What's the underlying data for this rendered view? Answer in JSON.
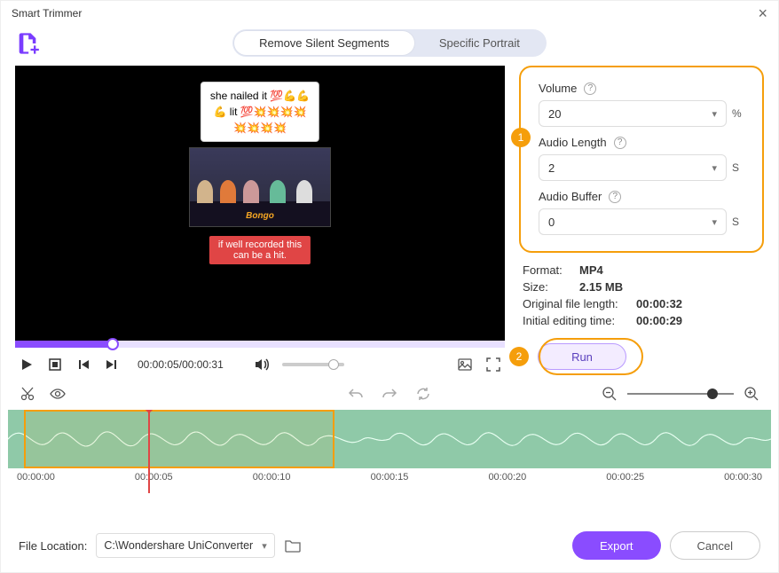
{
  "window": {
    "title": "Smart Trimmer"
  },
  "tabs": {
    "remove": "Remove Silent Segments",
    "portrait": "Specific Portrait"
  },
  "sticker": {
    "line1": "she nailed it 💯💪💪",
    "line2": "💪 lit 💯💥💥💥💥",
    "line3": "💥💥💥💥"
  },
  "caption": {
    "line1": "if well recorded this",
    "line2": "can be a hit."
  },
  "brand": "Bongo",
  "playback": {
    "current": "00:00:05",
    "total": "00:00:31"
  },
  "params": {
    "volume_label": "Volume",
    "volume_value": "20",
    "volume_unit": "%",
    "length_label": "Audio Length",
    "length_value": "2",
    "length_unit": "S",
    "buffer_label": "Audio Buffer",
    "buffer_value": "0",
    "buffer_unit": "S"
  },
  "meta": {
    "format_label": "Format:",
    "format_value": "MP4",
    "size_label": "Size:",
    "size_value": "2.15 MB",
    "orig_label": "Original file length:",
    "orig_value": "00:00:32",
    "init_label": "Initial editing time:",
    "init_value": "00:00:29"
  },
  "run": "Run",
  "badges": {
    "one": "1",
    "two": "2"
  },
  "ticks": [
    "00:00:00",
    "00:00:05",
    "00:00:10",
    "00:00:15",
    "00:00:20",
    "00:00:25",
    "00:00:30"
  ],
  "footer": {
    "loc_label": "File Location:",
    "path": "C:\\Wondershare UniConverter",
    "export": "Export",
    "cancel": "Cancel"
  }
}
